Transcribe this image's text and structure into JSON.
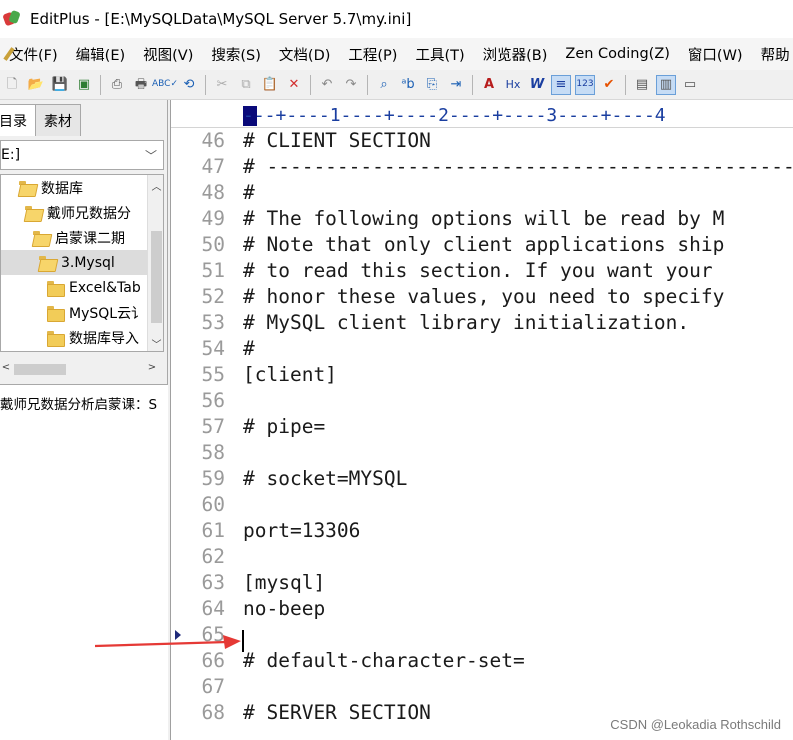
{
  "window": {
    "title": "EditPlus - [E:\\MySQLData\\MySQL Server 5.7\\my.ini]"
  },
  "menu": {
    "items": [
      "文件(F)",
      "编辑(E)",
      "视图(V)",
      "搜索(S)",
      "文档(D)",
      "工程(P)",
      "工具(T)",
      "浏览器(B)",
      "Zen Coding(Z)",
      "窗口(W)",
      "帮助"
    ]
  },
  "toolbar": {
    "icons": [
      "new-file-icon",
      "open-folder-icon",
      "save-icon",
      "save-all-icon",
      "print-preview-icon",
      "print-icon",
      "spell-check-icon",
      "browser-preview-icon",
      "cut-icon",
      "copy-icon",
      "paste-icon",
      "delete-icon",
      "undo-icon",
      "redo-icon",
      "find-icon",
      "replace-icon",
      "find-in-files-icon",
      "goto-line-icon",
      "font-size-icon",
      "hex-view-icon",
      "word-wrap-icon",
      "line-number-icon",
      "column-ruler-icon",
      "check-icon",
      "screen-mode-icon",
      "toggle-panel-icon",
      "output-window-icon"
    ]
  },
  "sidebar": {
    "tabs": [
      "目录",
      "素材"
    ],
    "drive": "E:]",
    "tree": [
      {
        "label": "数据库",
        "indent": 0,
        "open": true
      },
      {
        "label": "戴师兄数据分",
        "indent": 1,
        "open": true
      },
      {
        "label": "启蒙课二期",
        "indent": 2,
        "open": true
      },
      {
        "label": "3.Mysql",
        "indent": 3,
        "open": true,
        "selected": true
      },
      {
        "label": "Excel&Tab",
        "indent": 4,
        "open": false
      },
      {
        "label": "MySQL云讠",
        "indent": 4,
        "open": false
      },
      {
        "label": "数据库导入",
        "indent": 4,
        "open": false
      }
    ],
    "file_list_item": "戴师兄数据分析启蒙课：S"
  },
  "editor": {
    "ruler": "---+----1----+----2----+----3----+----4",
    "lines": [
      {
        "num": "46",
        "text": "# CLIENT SECTION"
      },
      {
        "num": "47",
        "text": "# ----------------------------------------------"
      },
      {
        "num": "48",
        "text": "#"
      },
      {
        "num": "49",
        "text": "# The following options will be read by M"
      },
      {
        "num": "50",
        "text": "# Note that only client applications ship"
      },
      {
        "num": "51",
        "text": "# to read this section. If you want your"
      },
      {
        "num": "52",
        "text": "# honor these values, you need to specify"
      },
      {
        "num": "53",
        "text": "# MySQL client library initialization."
      },
      {
        "num": "54",
        "text": "#"
      },
      {
        "num": "55",
        "text": "[client]"
      },
      {
        "num": "56",
        "text": ""
      },
      {
        "num": "57",
        "text": "# pipe="
      },
      {
        "num": "58",
        "text": ""
      },
      {
        "num": "59",
        "text": "# socket=MYSQL"
      },
      {
        "num": "60",
        "text": ""
      },
      {
        "num": "61",
        "text": "port=13306"
      },
      {
        "num": "62",
        "text": ""
      },
      {
        "num": "63",
        "text": "[mysql]"
      },
      {
        "num": "64",
        "text": "no-beep"
      },
      {
        "num": "65",
        "text": ""
      },
      {
        "num": "66",
        "text": "# default-character-set="
      },
      {
        "num": "67",
        "text": ""
      },
      {
        "num": "68",
        "text": "# SERVER SECTION"
      }
    ]
  },
  "watermark": "CSDN @Leokadia Rothschild",
  "colors": {
    "ruler_text": "#1a3ea0",
    "line_number": "#9a9a9a",
    "annotation_arrow": "#e53935"
  }
}
